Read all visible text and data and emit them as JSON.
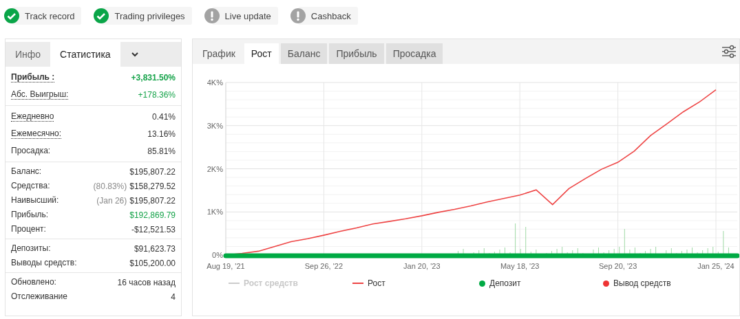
{
  "badges": [
    {
      "label": "Track record",
      "verified": true
    },
    {
      "label": "Trading privileges",
      "verified": true
    },
    {
      "label": "Live update",
      "verified": false
    },
    {
      "label": "Cashback",
      "verified": false
    }
  ],
  "stats_panel": {
    "tabs": [
      {
        "label": "Инфо",
        "selected": false
      },
      {
        "label": "Статистика",
        "selected": true
      }
    ],
    "sections": [
      {
        "rows": [
          {
            "label": "Прибыль :",
            "value": "+3,831.50%",
            "dotted": true,
            "bold": true,
            "positive": true
          },
          {
            "label": "Абс. Выигрыш:",
            "value": "+178.36%",
            "dotted": true,
            "bold": false,
            "positive": true
          }
        ]
      },
      {
        "rows": [
          {
            "label": "Ежедневно",
            "value": "0.41%",
            "dotted": true,
            "bold": false,
            "positive": false
          },
          {
            "label": "Ежемесячно:",
            "value": "13.16%",
            "dotted": true,
            "bold": false,
            "positive": false
          },
          {
            "label": "Просадка:",
            "value": "85.81%",
            "dotted": false,
            "bold": false,
            "positive": false
          }
        ]
      },
      {
        "rows": [
          {
            "label": "Баланс:",
            "value": "$195,807.22",
            "dotted": false,
            "bold": false,
            "positive": false
          },
          {
            "label": "Средства:",
            "note": "(80.83%)",
            "value": "$158,279.52",
            "dotted": false,
            "bold": false,
            "positive": false
          },
          {
            "label": "Наивысший:",
            "note": "(Jan 26)",
            "value": "$195,807.22",
            "dotted": false,
            "bold": false,
            "positive": false
          },
          {
            "label": "Прибыль:",
            "value": "$192,869.79",
            "dotted": false,
            "bold": false,
            "positive": true
          },
          {
            "label": "Процент:",
            "value": "-$12,521.53",
            "dotted": false,
            "bold": false,
            "positive": false
          }
        ]
      },
      {
        "rows": [
          {
            "label": "Депозиты:",
            "value": "$91,623.73",
            "dotted": false,
            "bold": false,
            "positive": false
          },
          {
            "label": "Выводы средств:",
            "value": "$105,200.00",
            "dotted": false,
            "bold": false,
            "positive": false
          }
        ]
      },
      {
        "rows": [
          {
            "label": "Обновлено:",
            "value": "16 часов назад",
            "dotted": false,
            "bold": false,
            "positive": false
          },
          {
            "label": "Отслеживание",
            "value": "4",
            "dotted": false,
            "bold": false,
            "positive": false
          }
        ]
      }
    ]
  },
  "chart_panel": {
    "tabs": [
      {
        "label": "График",
        "selected": false,
        "kind": "plain"
      },
      {
        "label": "Рост",
        "selected": true,
        "kind": "plain"
      },
      {
        "label": "Баланс",
        "selected": false,
        "kind": "shaded"
      },
      {
        "label": "Прибыль",
        "selected": false,
        "kind": "shaded"
      },
      {
        "label": "Просадка",
        "selected": false,
        "kind": "shaded"
      }
    ],
    "legend": [
      {
        "label": "Рост средств",
        "kind": "line",
        "disabled": true
      },
      {
        "label": "Рост",
        "kind": "line",
        "color": "#ee4444",
        "disabled": false
      },
      {
        "label": "Депозит",
        "kind": "dot",
        "color": "#00aa44",
        "disabled": false
      },
      {
        "label": "Вывод средств",
        "kind": "dot",
        "color": "#ee3333",
        "disabled": false
      }
    ],
    "chart_data": {
      "type": "line",
      "grid": true,
      "ylim": [
        0,
        4000
      ],
      "categories": [
        "Aug 19, '21",
        null,
        null,
        null,
        null,
        null,
        "Sep 26, '22",
        null,
        null,
        null,
        null,
        null,
        "Jan 20, '23",
        null,
        null,
        null,
        null,
        null,
        "May 18, '23",
        null,
        null,
        null,
        null,
        null,
        "Sep 20, '23",
        null,
        null,
        null,
        null,
        null,
        "Jan 25, '24"
      ],
      "yticks": [
        {
          "value": 0,
          "label": "0%"
        },
        {
          "value": 1000,
          "label": "1K%"
        },
        {
          "value": 2000,
          "label": "2K%"
        },
        {
          "value": 3000,
          "label": "3K%"
        },
        {
          "value": 4000,
          "label": "4K%"
        }
      ],
      "series": [
        {
          "color": "#ee4444",
          "values": [
            0,
            40,
            90,
            200,
            310,
            380,
            460,
            550,
            630,
            720,
            780,
            840,
            910,
            990,
            1060,
            1140,
            1230,
            1310,
            1390,
            1510,
            1170,
            1540,
            1770,
            1990,
            2150,
            2410,
            2770,
            3040,
            3320,
            3550,
            3830
          ]
        }
      ]
    }
  }
}
